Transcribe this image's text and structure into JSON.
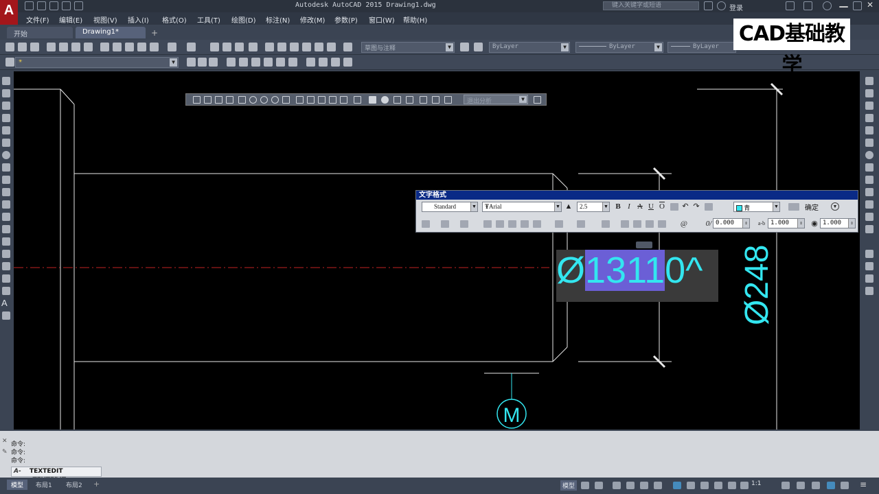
{
  "app": {
    "logo_letter": "A",
    "title": "Autodesk AutoCAD 2015   Drawing1.dwg",
    "search_placeholder": "键入关键字或短语",
    "user": "登录"
  },
  "menu": [
    "文件(F)",
    "编辑(E)",
    "视图(V)",
    "插入(I)",
    "格式(O)",
    "工具(T)",
    "绘图(D)",
    "标注(N)",
    "修改(M)",
    "参数(P)",
    "窗口(W)",
    "帮助(H)"
  ],
  "tabs": [
    {
      "label": "开始",
      "active": false
    },
    {
      "label": "Drawing1*",
      "active": true
    }
  ],
  "toolbar": {
    "workspace": "草图与注释",
    "layer": "ByLayer",
    "linetype": "ByLayer",
    "lineweight": "ByLayer",
    "color": "ByLayer",
    "float_combo": "退出分析"
  },
  "text_format": {
    "title": "文字格式",
    "style": "Standard",
    "font": "Arial",
    "height": "2.5",
    "bold": "B",
    "italic": "I",
    "strike": "A",
    "underline": "U",
    "overline": "O",
    "color": "青",
    "ok": "确定",
    "oblique": "0.000",
    "tracking": "1.000",
    "width_factor": "1.000"
  },
  "drawing": {
    "edit_text_prefix": "Ø",
    "edit_text_selected": "1311",
    "edit_text_suffix": "0^",
    "dim_text_vertical": "Ø248",
    "marker_letter": "M",
    "colors": {
      "cyan": "#33e6f0",
      "white": "#e8e8e8",
      "selection": "#6b5fd6",
      "centerline": "#c22222"
    }
  },
  "command": {
    "history": [
      "命令:",
      "命令:",
      "命令:"
    ],
    "input": "TEXTEDIT _TEXTEDIT"
  },
  "layout_tabs": [
    "模型",
    "布局1",
    "布局2"
  ],
  "status": {
    "model_label": "模型",
    "scale": "1:1"
  },
  "watermark": "CAD基础教学"
}
